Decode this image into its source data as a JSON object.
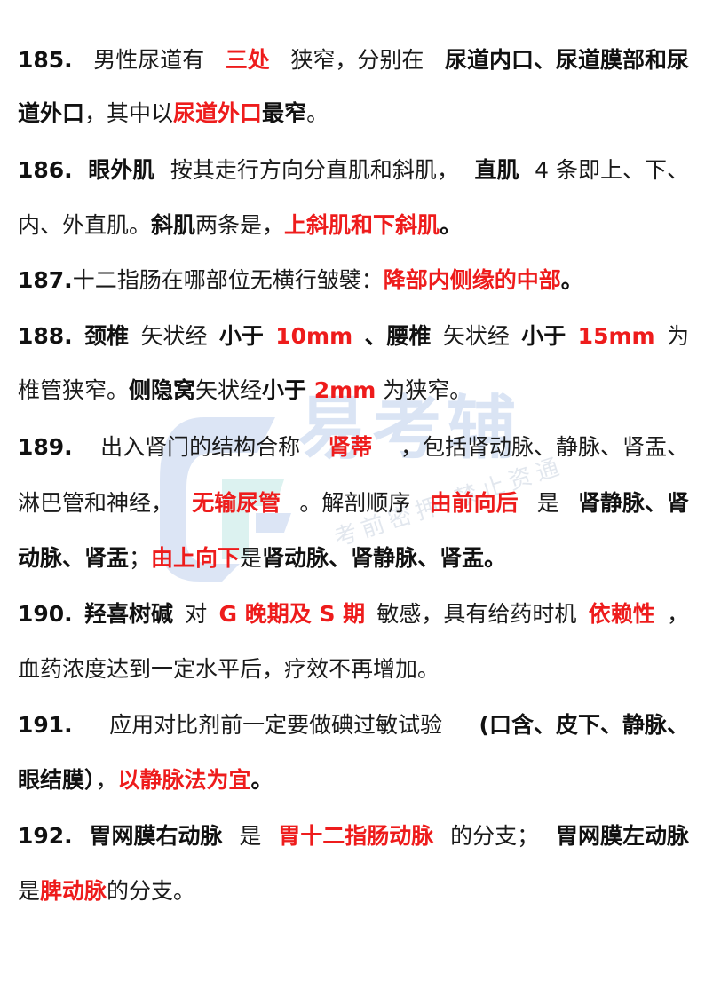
{
  "watermark": {
    "title": "易考辅",
    "subtitle": "考前密押 禁止资通",
    "color": "#2a63c4"
  },
  "colors": {
    "red": "#ee1c1c",
    "black": "#111111"
  },
  "items": {
    "i185": {
      "num": "185.",
      "t1": "男性尿道有",
      "r1": "三处",
      "t2": "狭窄，分别在",
      "b1": "尿道内口、尿道膜部和尿",
      "b2": "道外口",
      "t3": "，其中以",
      "r2": "尿道外口",
      "b3": "最窄",
      "t4": "。"
    },
    "i186": {
      "num": "186.",
      "b1": "眼外肌",
      "t1": "按其走行方向分直肌和斜肌，",
      "b2": "直肌",
      "t2": " 4 条即上、下、",
      "t3": "内、外直肌。",
      "b3": "斜肌",
      "t4": "两条是，",
      "r1": "上斜肌和下斜肌",
      "t5": "。"
    },
    "i187": {
      "num": "187.",
      "t1": "十二指肠在哪部位无横行皱襞：",
      "r1": "降部内侧缘的中部",
      "t2": "。"
    },
    "i188": {
      "num": "188.",
      "b1": "颈椎",
      "t1": "矢状经",
      "b2": "小于",
      "r1": " 10mm",
      "b3": "、腰椎",
      "t2": "矢状经",
      "b4": "小于",
      "r2": " 15mm",
      "t3": " 为",
      "t4": "椎管狭窄。",
      "b5": "侧隐窝",
      "t5": "矢状经",
      "b6": "小于",
      "r3": " 2mm",
      "t6": " 为狭窄。"
    },
    "i189": {
      "num": "189.",
      "t1": "出入肾门的结构合称",
      "r1": "肾蒂",
      "t2": "，包括肾动脉、静脉、肾盂、",
      "t3": "淋巴管和神经，",
      "r2": "无输尿管",
      "t4": "。解剖顺序",
      "r3": "由前向后",
      "t5": "是",
      "b1": "肾静脉、肾",
      "b2": "动脉、肾盂",
      "t6": "；",
      "r4": "由上向下",
      "t7": "是",
      "b3": "肾动脉、肾静脉、肾盂。"
    },
    "i190": {
      "num": "190.",
      "b1": "羟喜树碱",
      "t1": "对 ",
      "r1": "G 晚期及 S 期",
      "t2": "敏感，具有给药时机",
      "r2": "依赖性",
      "t3": "，",
      "t4": "血药浓度达到一定水平后，疗效不再增加。"
    },
    "i191": {
      "num": "191.",
      "t1": "应用对比剂前一定要做碘过敏试验 ",
      "b1": "(口含、皮下、静脉、",
      "b2": "眼结膜）",
      "t2": "，",
      "r1": "以静脉法为宜",
      "t3": "。"
    },
    "i192": {
      "num": "192.",
      "b1": "胃网膜右动脉",
      "t1": "是",
      "r1": "胃十二指肠动脉",
      "t2": "的分支；",
      "b2": "胃网膜左动脉",
      "t3": "是",
      "r2": "脾动脉",
      "t4": "的分支。"
    }
  }
}
